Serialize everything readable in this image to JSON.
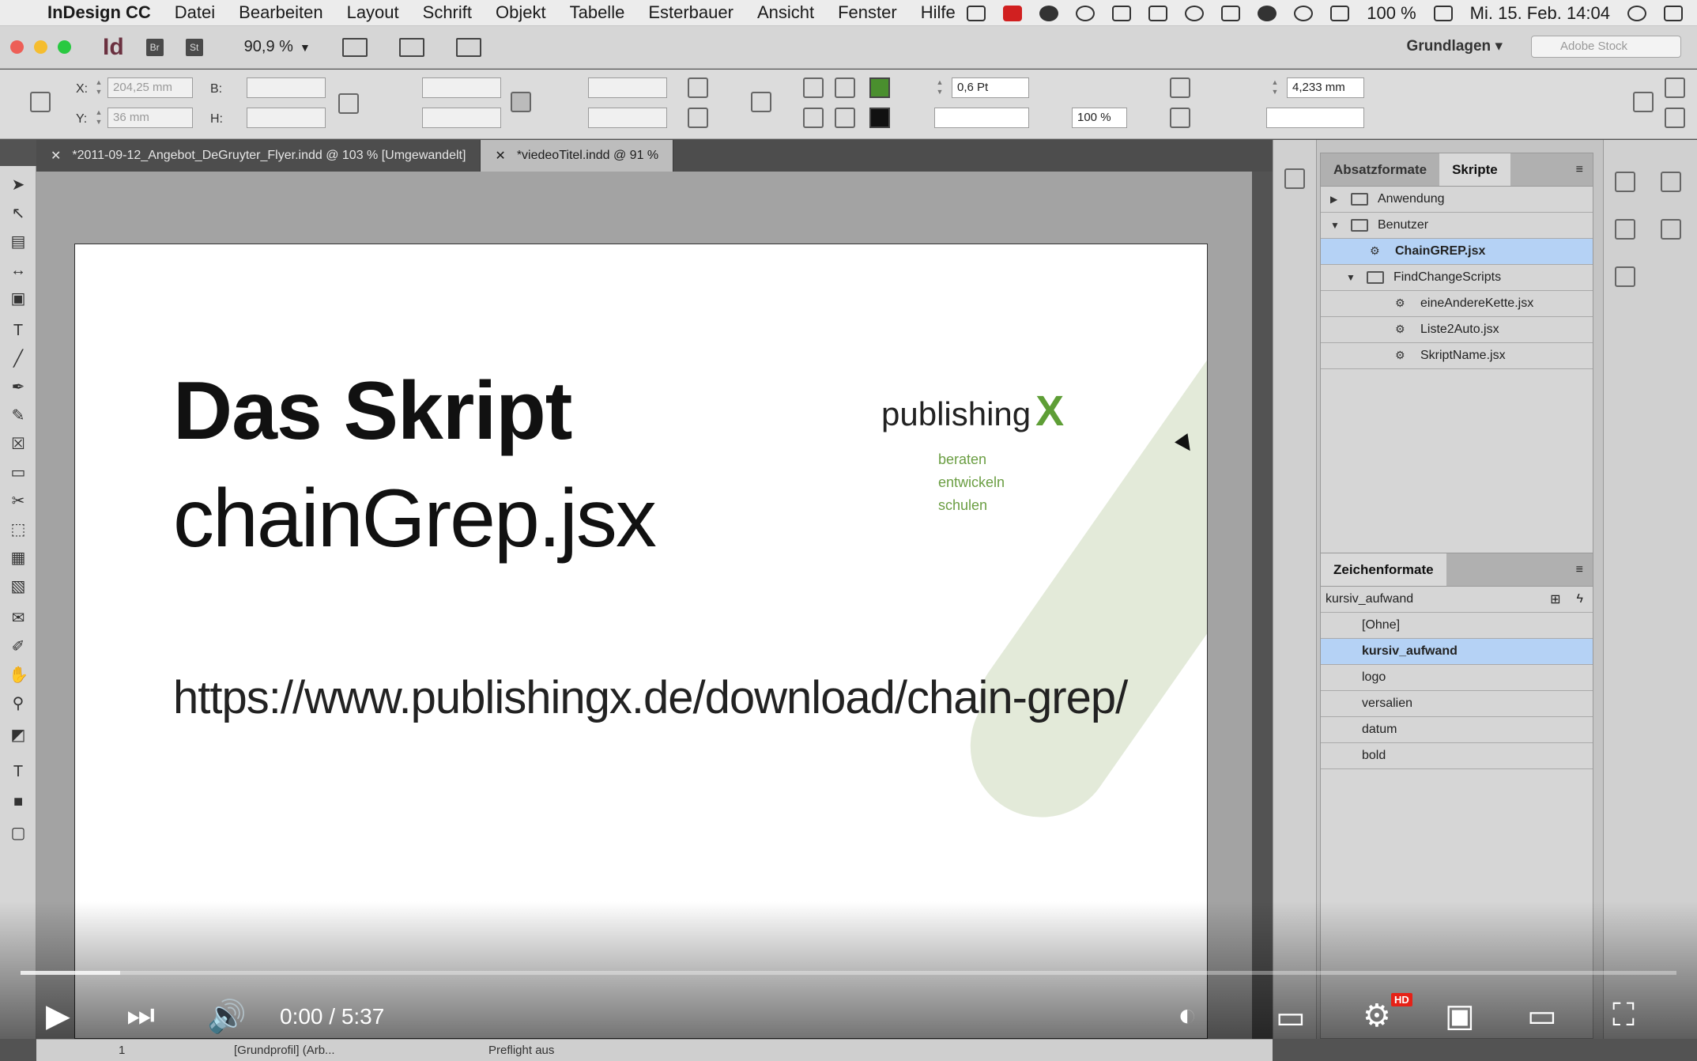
{
  "menubar": {
    "app_name": "InDesign CC",
    "items": [
      "Datei",
      "Bearbeiten",
      "Layout",
      "Schrift",
      "Objekt",
      "Tabelle",
      "Esterbauer",
      "Ansicht",
      "Fenster",
      "Hilfe"
    ],
    "battery": "100 %",
    "datetime": "Mi. 15. Feb. 14:04"
  },
  "approw": {
    "logo": "Id",
    "bridge": "Br",
    "stock_btn": "St",
    "zoom": "90,9 %",
    "workspace": "Grundlagen",
    "stock_placeholder": "Adobe Stock"
  },
  "control": {
    "x_label": "X:",
    "x_value": "204,25 mm",
    "y_label": "Y:",
    "y_value": "36 mm",
    "b_label": "B:",
    "h_label": "H:",
    "stroke_weight": "0,6 Pt",
    "scale": "100 %",
    "offset": "4,233 mm",
    "fill_color": "#4a8f2e"
  },
  "doctabs": [
    {
      "label": "*2011-09-12_Angebot_DeGruyter_Flyer.indd @ 103 % [Umgewandelt]",
      "active": false
    },
    {
      "label": "*viedeoTitel.indd @ 91 %",
      "active": true
    }
  ],
  "page": {
    "heading_bold": "Das Skript",
    "heading_regular": "chainGrep.jsx",
    "url": "https://www.publishingx.de/download/chain-grep/",
    "logo_word": "publishing",
    "logo_x": "X",
    "tagline": [
      "beraten",
      "entwickeln",
      "schulen"
    ]
  },
  "scripts_panel": {
    "tab_inactive": "Absatzformate",
    "tab_active": "Skripte",
    "items": [
      {
        "label": "Anwendung",
        "kind": "folder",
        "indent": 0,
        "open": false,
        "selected": false
      },
      {
        "label": "Benutzer",
        "kind": "folder",
        "indent": 0,
        "open": true,
        "selected": false
      },
      {
        "label": "ChainGREP.jsx",
        "kind": "script",
        "indent": 1,
        "selected": true
      },
      {
        "label": "FindChangeScripts",
        "kind": "folder",
        "indent": 1,
        "open": true,
        "selected": false
      },
      {
        "label": "eineAndereKette.jsx",
        "kind": "script",
        "indent": 2,
        "selected": false
      },
      {
        "label": "Liste2Auto.jsx",
        "kind": "script",
        "indent": 2,
        "selected": false
      },
      {
        "label": "SkriptName.jsx",
        "kind": "script",
        "indent": 2,
        "selected": false
      }
    ]
  },
  "char_panel": {
    "title": "Zeichenformate",
    "current": "kursiv_aufwand",
    "items": [
      {
        "label": "[Ohne]",
        "selected": false
      },
      {
        "label": "kursiv_aufwand",
        "selected": true
      },
      {
        "label": "logo",
        "selected": false
      },
      {
        "label": "versalien",
        "selected": false
      },
      {
        "label": "datum",
        "selected": false
      },
      {
        "label": "bold",
        "selected": false
      }
    ]
  },
  "video": {
    "time": "0:00 / 5:37",
    "progress": 0.06,
    "hd_badge": "HD"
  },
  "status": {
    "page": "1",
    "profile": "[Grundprofil] (Arb...",
    "preflight": "Preflight aus"
  }
}
